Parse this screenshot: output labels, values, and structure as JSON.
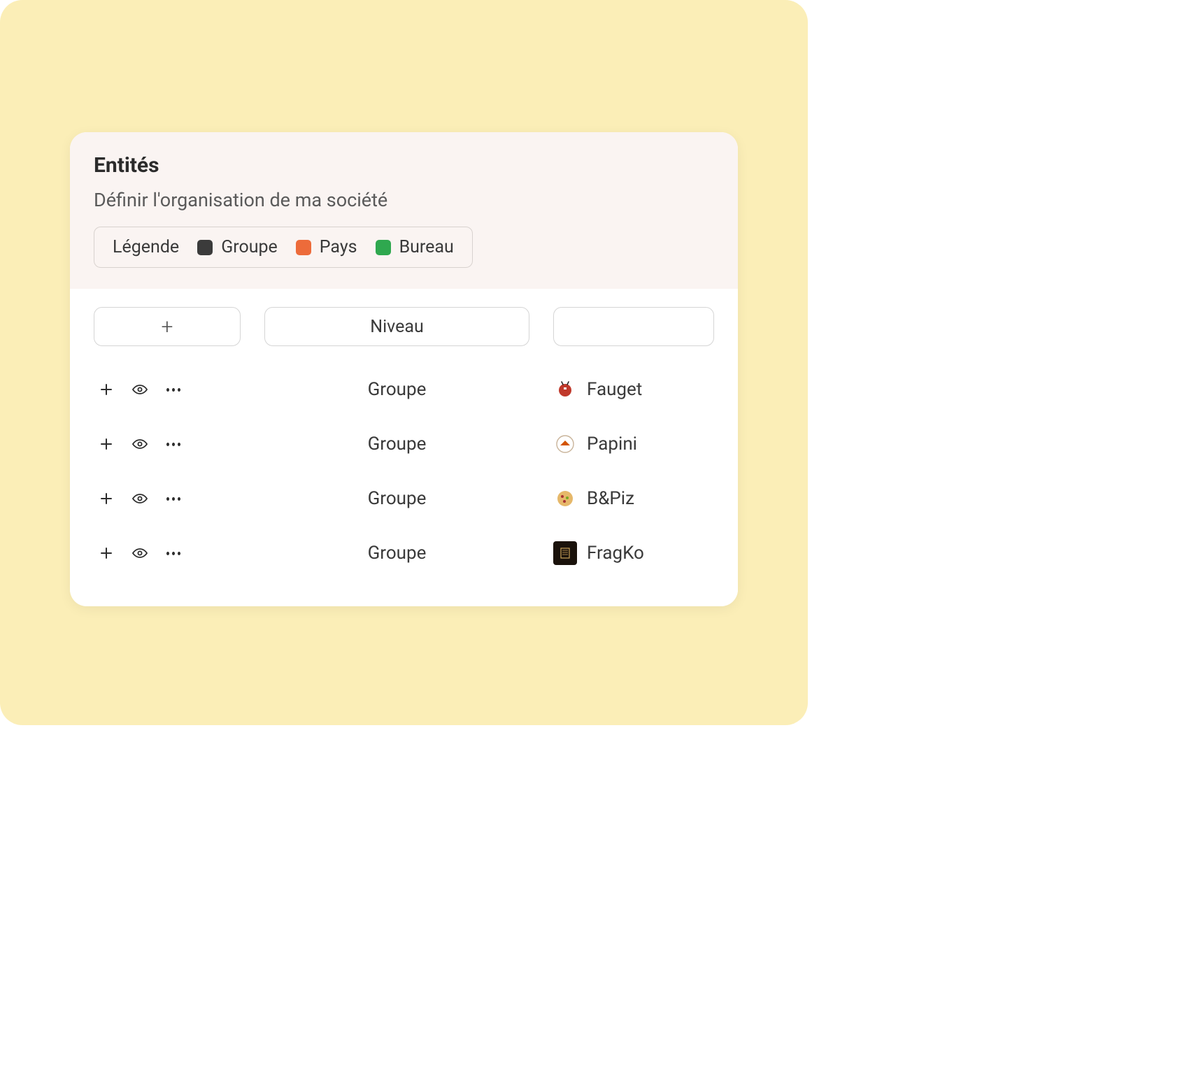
{
  "header": {
    "title": "Entités",
    "subtitle": "Définir l'organisation de ma société"
  },
  "legend": {
    "label": "Légende",
    "items": [
      {
        "label": "Groupe",
        "color": "#3b3b3b"
      },
      {
        "label": "Pays",
        "color": "#ed6b3a"
      },
      {
        "label": "Bureau",
        "color": "#2fa84f"
      }
    ]
  },
  "columns": {
    "add": "+",
    "level": "Niveau",
    "entity": ""
  },
  "rows": [
    {
      "level": "Groupe",
      "name": "Fauget",
      "logo_bg": "#ffffff",
      "logo_fg": "#c0392b",
      "logo_shape": "round"
    },
    {
      "level": "Groupe",
      "name": "Papini",
      "logo_bg": "#ffffff",
      "logo_fg": "#d35400",
      "logo_shape": "round-border"
    },
    {
      "level": "Groupe",
      "name": "B&Piz",
      "logo_bg": "#ffffff",
      "logo_fg": "#e08a2c",
      "logo_shape": "round"
    },
    {
      "level": "Groupe",
      "name": "FragKo",
      "logo_bg": "#1a120b",
      "logo_fg": "#c9a15a",
      "logo_shape": "square"
    }
  ]
}
